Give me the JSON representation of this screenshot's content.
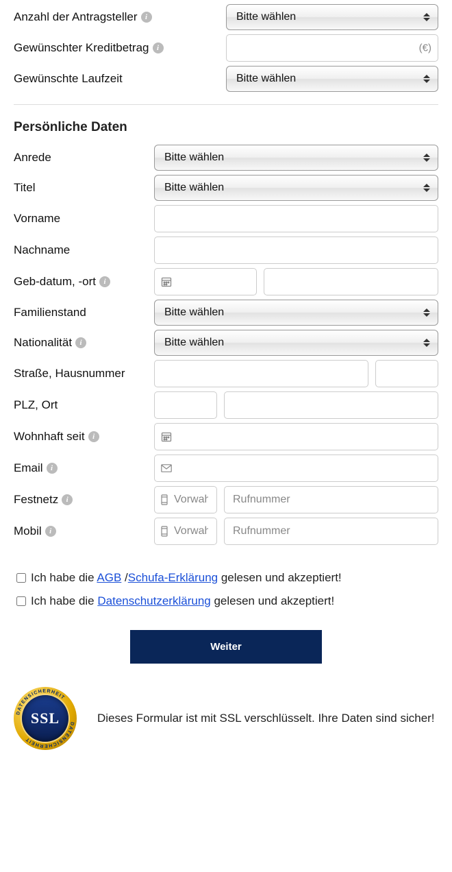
{
  "loan": {
    "applicants_label": "Anzahl der Antragsteller",
    "applicants_placeholder": "Bitte wählen",
    "amount_label": "Gewünschter Kreditbetrag",
    "amount_suffix": "(€)",
    "term_label": "Gewünschte Laufzeit",
    "term_placeholder": "Bitte wählen"
  },
  "personal": {
    "heading": "Persönliche Daten",
    "salutation_label": "Anrede",
    "salutation_placeholder": "Bitte wählen",
    "title_label": "Titel",
    "title_placeholder": "Bitte wählen",
    "firstname_label": "Vorname",
    "lastname_label": "Nachname",
    "birth_label": "Geb-datum, -ort",
    "marital_label": "Familienstand",
    "marital_placeholder": "Bitte wählen",
    "nationality_label": "Nationalität",
    "nationality_placeholder": "Bitte wählen",
    "street_label": "Straße, Hausnummer",
    "plz_label": "PLZ, Ort",
    "resident_label": "Wohnhaft seit",
    "email_label": "Email",
    "landline_label": "Festnetz",
    "mobile_label": "Mobil",
    "areacode_placeholder": "Vorwahl",
    "number_placeholder": "Rufnummer"
  },
  "consents": {
    "line1_pre": "Ich habe die ",
    "line1_link1": "AGB",
    "line1_sep": " /",
    "line1_link2": "Schufa-Erklärung",
    "line1_post": " gelesen und akzeptiert!",
    "line2_pre": "Ich habe die ",
    "line2_link": "Datenschutzerklärung",
    "line2_post": " gelesen und akzeptiert!"
  },
  "submit_label": "Weiter",
  "ssl": {
    "badge": "SSL",
    "ring": "DATENSICHERHEIT",
    "message": "Dieses Formular ist mit SSL verschlüsselt. Ihre Daten sind sicher!"
  }
}
